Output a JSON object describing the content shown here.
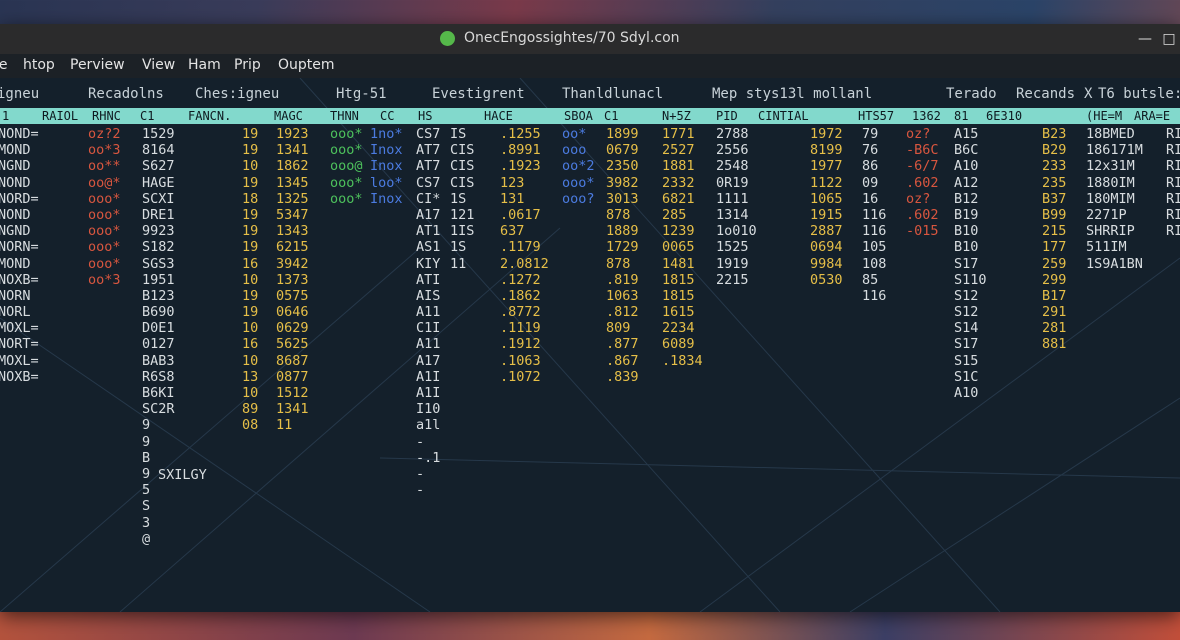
{
  "window": {
    "title": "OnecEngossightes/70 Sdyl.con",
    "min_icon": "minimize-icon",
    "max_icon": "maximize-icon",
    "close_icon": "close-icon",
    "min": "—",
    "max": "□",
    "close": "✕"
  },
  "menu": [
    "le",
    "htop",
    "Perview",
    "View",
    "Ham",
    "Prip",
    "Ouptem"
  ],
  "captions": [
    "igneu",
    "Recadolns",
    "Ches:igneu",
    "Htg-51",
    "Evestigrent",
    "Thanldlunacl",
    "Mep stys13l mollanl",
    "Terado",
    "Recands",
    "X",
    "T6 butsle:"
  ],
  "headers": [
    "1",
    "RAIOL",
    "RHNC",
    "C1",
    "FANCN.",
    "MAGC",
    "THNN",
    "CC",
    "HS",
    "HACE",
    "SBOA",
    "C1",
    "N+5Z",
    "PID",
    "CINTIAL",
    "HTS57",
    "1362",
    "81",
    "6E310",
    "(HE=M",
    "ARA=E"
  ],
  "cols": {
    "c0": [
      "NOND=",
      "MOND",
      "NGND",
      "NOND",
      "NORD=",
      "NOND",
      "NGND",
      "NORN=",
      "MOND",
      "NOXB=",
      "NORN",
      "NORL",
      "MOXL=",
      "NORT=",
      "MOXL=",
      "NOXB="
    ],
    "c1": [
      "oz?2",
      "oo*3",
      "oo**",
      "oo@*",
      "ooo*",
      "ooo*",
      "ooo*",
      "ooo*",
      "ooo*",
      "oo*3"
    ],
    "c2": [
      "1529",
      "8164",
      "S627",
      "HAGE",
      "SCXI",
      "DRE1",
      "9923",
      "S182",
      "SGS3",
      "1951",
      "B123",
      "B690",
      "D0E1",
      "0127",
      "BAB3",
      "R6S8",
      "B6KI",
      "SC2R",
      "9",
      "9",
      "B",
      "9",
      "5",
      "S",
      "3",
      "@"
    ],
    "c3": [
      "19",
      "19",
      "10",
      "19",
      "18",
      "19",
      "19",
      "19",
      "16",
      "10",
      "19",
      "19",
      "10",
      "16",
      "10",
      "13",
      "10",
      "89",
      "08"
    ],
    "c4": [
      "1923",
      "1341",
      "1862",
      "1345",
      "1325",
      "5347",
      "1343",
      "6215",
      "3942",
      "1373",
      "0575",
      "0646",
      "0629",
      "5625",
      "8687",
      "0877",
      "1512",
      "1341",
      "11"
    ],
    "c5": [
      "ooo*",
      "ooo*",
      "ooo@",
      "ooo*",
      "ooo*"
    ],
    "c6": [
      "1no*",
      "Inox",
      "Inox",
      "loo*",
      "Inox"
    ],
    "c7": [
      "CS7",
      "AT7",
      "AT7",
      "CS7",
      "CI*",
      "A17",
      "AT1",
      "AS1",
      "KIY",
      "ATI",
      "AIS",
      "A11",
      "C1I",
      "A11",
      "A17",
      "A1I",
      "A1I",
      "I10",
      "a1l",
      "-",
      "-.1",
      "-",
      "-"
    ],
    "c8": [
      "IS",
      "CIS",
      "CIS",
      "CIS",
      "1S",
      "121",
      "1IS",
      "1S",
      "11"
    ],
    "c9": [
      ".1255",
      ".8991",
      ".1923",
      "123",
      "131",
      ".0617",
      "637",
      ".1179",
      "2.0812",
      ".1272",
      ".1862",
      ".8772",
      ".1119",
      ".1912",
      ".1063",
      ".1072"
    ],
    "c10": [
      "oo*",
      "ooo",
      "oo*2",
      "ooo*",
      "ooo?"
    ],
    "c11": [
      "1899",
      "0679",
      "2350",
      "3982",
      "3013",
      "878",
      "1889",
      "1729",
      "878",
      ".819",
      "1063",
      ".812",
      "809",
      ".877",
      ".867",
      ".839"
    ],
    "c12": [
      "1771",
      "2527",
      "1881",
      "2332",
      "6821",
      "285",
      "1239",
      "0065",
      "1481",
      "1815",
      "1815",
      "1615",
      "2234",
      "6089",
      ".1834"
    ],
    "c13": [
      "2788",
      "2556",
      "2548",
      "0R19",
      "1111",
      "1314",
      "1o010",
      "1525",
      "1919",
      "2215"
    ],
    "c14": [
      "1972",
      "8199",
      "1977",
      "1122",
      "1065",
      "1915",
      "2887",
      "0694",
      "9984",
      "0530"
    ],
    "c15": [
      "79",
      "76",
      "86",
      "09",
      "16",
      "116",
      "116",
      "105",
      "108",
      "85",
      "116"
    ],
    "c16": [
      "oz?",
      "-B6C",
      "-6/7",
      ".602",
      "oz?",
      ".602",
      "-015"
    ],
    "c17": [
      "A15",
      "B6C",
      "A10",
      "A12",
      "B12",
      "B19",
      "B10",
      "B10",
      "S17",
      "S110",
      "S12",
      "S12",
      "S14",
      "S17",
      "S15",
      "S1C",
      "A10"
    ],
    "c18": [
      "B23",
      "B29",
      "233",
      "235",
      "B37",
      "B99",
      "215",
      "177",
      "259",
      "299",
      "B17",
      "291",
      "281",
      "881"
    ],
    "c19": [
      "18BMED",
      "186171M",
      "12x31M",
      "1880IM",
      "180MIM",
      "2271P",
      "SHRRIP",
      "511IM",
      "1S9A1BN"
    ],
    "c20": [
      "RI",
      "RI",
      "RI",
      "RI",
      "RI",
      "RI",
      "RI"
    ],
    "extra": {
      "sm": "SXILGY"
    }
  }
}
